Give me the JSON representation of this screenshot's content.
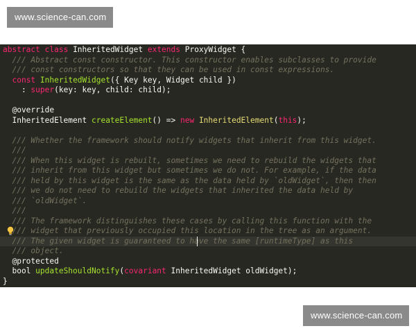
{
  "watermarks": {
    "top": "www.science-can.com",
    "bottom": "www.science-can.com"
  },
  "editor": {
    "background": "#272822",
    "lines": [
      {
        "tokens": [
          [
            "kw",
            "abstract"
          ],
          [
            "plain",
            " "
          ],
          [
            "kw",
            "class"
          ],
          [
            "plain",
            " InheritedWidget "
          ],
          [
            "kw",
            "extends"
          ],
          [
            "plain",
            " ProxyWidget {"
          ]
        ]
      },
      {
        "tokens": [
          [
            "cm",
            "  /// Abstract const constructor. This constructor enables subclasses to provide"
          ]
        ]
      },
      {
        "tokens": [
          [
            "cm",
            "  /// const constructors so that they can be used in const expressions."
          ]
        ]
      },
      {
        "tokens": [
          [
            "plain",
            "  "
          ],
          [
            "kw",
            "const"
          ],
          [
            "plain",
            " "
          ],
          [
            "fn",
            "InheritedWidget"
          ],
          [
            "plain",
            "({ Key key, Widget child })"
          ]
        ]
      },
      {
        "tokens": [
          [
            "plain",
            "    : "
          ],
          [
            "kw",
            "super"
          ],
          [
            "plain",
            "(key: key, child: child);"
          ]
        ]
      },
      {
        "tokens": []
      },
      {
        "tokens": [
          [
            "ann",
            "  @override"
          ]
        ]
      },
      {
        "tokens": [
          [
            "plain",
            "  InheritedElement "
          ],
          [
            "fn",
            "createElement"
          ],
          [
            "plain",
            "() => "
          ],
          [
            "kw",
            "new"
          ],
          [
            "plain",
            " "
          ],
          [
            "cls",
            "InheritedElement"
          ],
          [
            "plain",
            "("
          ],
          [
            "kw",
            "this"
          ],
          [
            "plain",
            ");"
          ]
        ]
      },
      {
        "tokens": []
      },
      {
        "tokens": [
          [
            "cm",
            "  /// Whether the framework should notify widgets that inherit from this widget."
          ]
        ]
      },
      {
        "tokens": [
          [
            "cm",
            "  ///"
          ]
        ]
      },
      {
        "tokens": [
          [
            "cm",
            "  /// When this widget is rebuilt, sometimes we need to rebuild the widgets that"
          ]
        ]
      },
      {
        "tokens": [
          [
            "cm",
            "  /// inherit from this widget but sometimes we do not. For example, if the data"
          ]
        ]
      },
      {
        "tokens": [
          [
            "cm",
            "  /// held by this widget is the same as the data held by `oldWidget`, then then"
          ]
        ]
      },
      {
        "tokens": [
          [
            "cm",
            "  /// we do not need to rebuild the widgets that inherited the data held by"
          ]
        ]
      },
      {
        "tokens": [
          [
            "cm",
            "  /// `oldWidget`."
          ]
        ]
      },
      {
        "tokens": [
          [
            "cm",
            "  ///"
          ]
        ]
      },
      {
        "tokens": [
          [
            "cm",
            "  /// The framework distinguishes these cases by calling this function with the"
          ]
        ]
      },
      {
        "tokens": [
          [
            "cm",
            "  /// widget that previously occupied this location in the tree as an argument."
          ]
        ]
      },
      {
        "tokens": [
          [
            "cm",
            "  /// The given widget is guaranteed to have the same [runtimeType] as this"
          ]
        ],
        "current": true
      },
      {
        "tokens": [
          [
            "cm",
            "  /// object."
          ]
        ]
      },
      {
        "tokens": [
          [
            "ann",
            "  @protected"
          ]
        ]
      },
      {
        "tokens": [
          [
            "plain",
            "  bool "
          ],
          [
            "fn",
            "updateShouldNotify"
          ],
          [
            "plain",
            "("
          ],
          [
            "kw",
            "covariant"
          ],
          [
            "plain",
            " InheritedWidget oldWidget);"
          ]
        ]
      },
      {
        "tokens": [
          [
            "plain",
            "}"
          ]
        ]
      }
    ]
  },
  "icons": {
    "gutter": "lightbulb-icon"
  }
}
